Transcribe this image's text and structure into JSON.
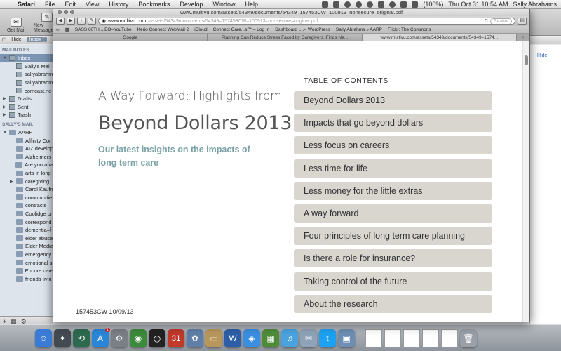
{
  "menubar": {
    "app": "Safari",
    "items": [
      "File",
      "Edit",
      "View",
      "History",
      "Bookmarks",
      "Develop",
      "Window",
      "Help"
    ],
    "battery": "(100%)",
    "clock": "Thu Oct 31  10:54 AM",
    "user": "Sally Abrahams"
  },
  "mail": {
    "toolbar": {
      "get_mail": "Get Mail",
      "new_message": "New Message"
    },
    "subbar": {
      "hide": "Hide",
      "inbox_tab": "Inbox ("
    },
    "sections": {
      "mailboxes": "MAILBOXES",
      "sallys_mail": "SALLY'S MAIL"
    },
    "mailboxes": [
      {
        "label": "Inbox",
        "selected": true,
        "arrow": "▼",
        "indent": false
      },
      {
        "label": "Sally's Mail",
        "selected": false,
        "arrow": "",
        "indent": true
      },
      {
        "label": "sallyabrahm",
        "selected": false,
        "arrow": "",
        "indent": true
      },
      {
        "label": "sallyabrahm",
        "selected": false,
        "arrow": "",
        "indent": true
      },
      {
        "label": "comcast.ne",
        "selected": false,
        "arrow": "",
        "indent": true
      },
      {
        "label": "Drafts",
        "selected": false,
        "arrow": "▶",
        "indent": false
      },
      {
        "label": "Sent",
        "selected": false,
        "arrow": "▶",
        "indent": false
      },
      {
        "label": "Trash",
        "selected": false,
        "arrow": "▶",
        "indent": false
      }
    ],
    "folders": [
      {
        "label": "AARP",
        "arrow": "▼",
        "indent": false
      },
      {
        "label": "Affinity Cor",
        "arrow": "",
        "indent": true
      },
      {
        "label": "AIZ develop",
        "arrow": "",
        "indent": true
      },
      {
        "label": "Alzheimers",
        "arrow": "",
        "indent": true
      },
      {
        "label": "Are you afra",
        "arrow": "",
        "indent": true
      },
      {
        "label": "arts in long",
        "arrow": "",
        "indent": true
      },
      {
        "label": "caregiving",
        "arrow": "▶",
        "indent": true
      },
      {
        "label": "Carol Kaufn",
        "arrow": "",
        "indent": true
      },
      {
        "label": "communitie",
        "arrow": "",
        "indent": true
      },
      {
        "label": "contracts",
        "arrow": "",
        "indent": true
      },
      {
        "label": "Coolidge pr",
        "arrow": "",
        "indent": true
      },
      {
        "label": "correspond",
        "arrow": "",
        "indent": true
      },
      {
        "label": "dementia–f",
        "arrow": "",
        "indent": true
      },
      {
        "label": "elder abuse",
        "arrow": "",
        "indent": true
      },
      {
        "label": "Elder Media",
        "arrow": "",
        "indent": true
      },
      {
        "label": "emergency",
        "arrow": "",
        "indent": true
      },
      {
        "label": "emotional s",
        "arrow": "",
        "indent": true
      },
      {
        "label": "Encore care",
        "arrow": "",
        "indent": true
      },
      {
        "label": "friends livin",
        "arrow": "",
        "indent": true
      }
    ],
    "bottom_controls": [
      "+",
      "▦",
      "⚙"
    ],
    "right_pane_link": "Hide"
  },
  "safari": {
    "title": "www.multivu.com/assets/54349/documents/54349–157453CW–100913–nonsecure–original.pdf",
    "url_domain": "www.multivu.com",
    "url_path": "/assets/54349/documents/54349–157453CW–100913–nonsecure–original.pdf",
    "reload": "C",
    "reader": "Reader",
    "bookmarks": [
      "SASS 60TH ...EO–YouTube",
      "Kerio Connect WebMail 2",
      "iCloud",
      "Connect Care...s™ – Log In",
      "Dashboard ‹...– WordPress",
      "Sally Abrahms » AARP",
      "Flickr: The Commons"
    ],
    "tabs": [
      {
        "label": "Google",
        "active": false
      },
      {
        "label": "Planning Can Reduce Stress Faced by Caregivers, Finds Ne...",
        "active": false
      },
      {
        "label": "www.multivu.com/assets/54349/documents/54349–1574...",
        "active": true
      }
    ],
    "new_tab": "+"
  },
  "pdf": {
    "heading_small": "A Way Forward: Highlights from",
    "heading_big": "Beyond Dollars 2013",
    "subtitle": "Our latest insights on the impacts of long term care",
    "footer": "157453CW  10/09/13",
    "toc_title": "TABLE OF CONTENTS",
    "toc": [
      "Beyond Dollars 2013",
      "Impacts that go beyond dollars",
      "Less focus on careers",
      "Less time for life",
      "Less money for the little extras",
      "A way forward",
      "Four principles of long term care planning",
      "Is there a role for insurance?",
      "Taking control of the future",
      "About the research"
    ]
  },
  "dock": {
    "apps": [
      {
        "name": "finder-icon",
        "color": "#3a7bd5",
        "glyph": "☺"
      },
      {
        "name": "launchpad-icon",
        "color": "#444a52",
        "glyph": "✦"
      },
      {
        "name": "time-machine-icon",
        "color": "#2d6a4f",
        "glyph": "⟲"
      },
      {
        "name": "app-store-icon",
        "color": "#2a87d8",
        "glyph": "A",
        "badge": "1"
      },
      {
        "name": "system-preferences-icon",
        "color": "#7b7f86",
        "glyph": "⚙"
      },
      {
        "name": "facetime-icon",
        "color": "#3c8a3c",
        "glyph": "◉"
      },
      {
        "name": "camera-icon",
        "color": "#222",
        "glyph": "◎"
      },
      {
        "name": "calendar-icon",
        "color": "#c0392b",
        "glyph": "31"
      },
      {
        "name": "photo-icon",
        "color": "#5f7fa8",
        "glyph": "✿"
      },
      {
        "name": "folder-icon",
        "color": "#b8975c",
        "glyph": "▭"
      },
      {
        "name": "word-icon",
        "color": "#2e5ea8",
        "glyph": "W"
      },
      {
        "name": "safari-icon",
        "color": "#3b8fe0",
        "glyph": "◈"
      },
      {
        "name": "spreadsheet-icon",
        "color": "#4f8c3a",
        "glyph": "▦"
      },
      {
        "name": "itunes-icon",
        "color": "#4aa3df",
        "glyph": "♫"
      },
      {
        "name": "mail-icon",
        "color": "#8fa3b8",
        "glyph": "✉"
      },
      {
        "name": "twitter-icon",
        "color": "#1da1f2",
        "glyph": "t"
      },
      {
        "name": "preview-icon",
        "color": "#6d8fb3",
        "glyph": "▣"
      }
    ],
    "docs": 5,
    "trash_glyph": "🗑"
  }
}
